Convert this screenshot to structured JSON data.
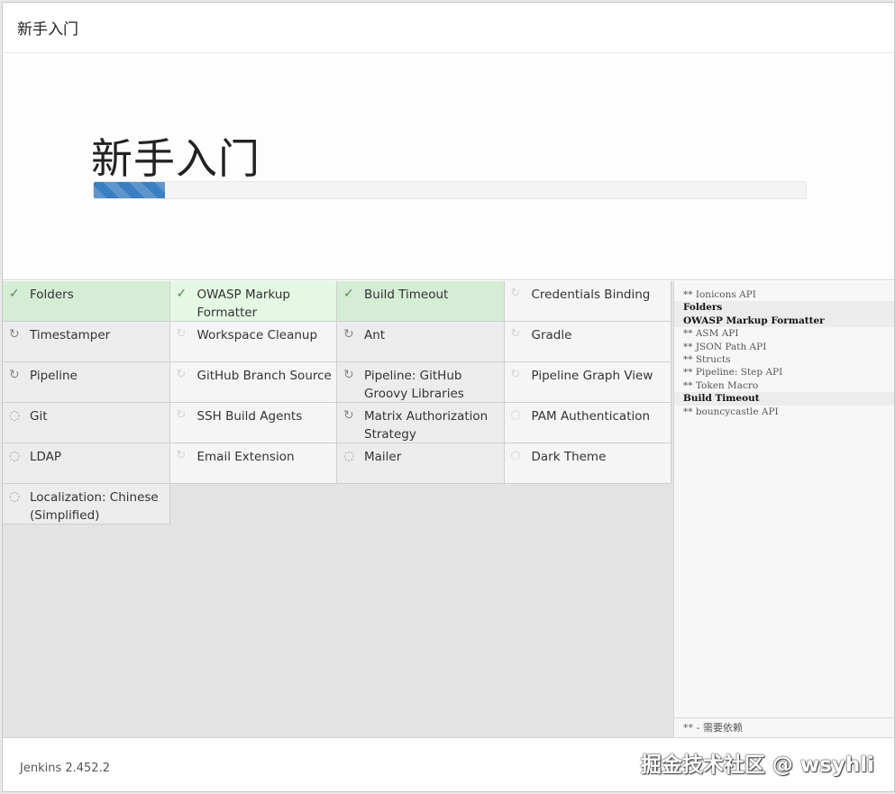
{
  "header": {
    "title": "新手入门"
  },
  "hero": {
    "title": "新手入门",
    "progress_percent": 10
  },
  "plugins": [
    {
      "label": "Folders",
      "status": "success",
      "icon": "check-icon"
    },
    {
      "label": "OWASP Markup Formatter",
      "status": "success-light",
      "icon": "check-icon"
    },
    {
      "label": "Build Timeout",
      "status": "success",
      "icon": "check-icon"
    },
    {
      "label": "Credentials Binding",
      "status": "queued-pending",
      "icon": "refresh-icon"
    },
    {
      "label": "Timestamper",
      "status": "pending",
      "icon": "refresh-icon"
    },
    {
      "label": "Workspace Cleanup",
      "status": "queued-pending",
      "icon": "refresh-icon"
    },
    {
      "label": "Ant",
      "status": "pending",
      "icon": "refresh-icon"
    },
    {
      "label": "Gradle",
      "status": "queued-pending",
      "icon": "refresh-icon"
    },
    {
      "label": "Pipeline",
      "status": "pending",
      "icon": "refresh-icon"
    },
    {
      "label": "GitHub Branch Source",
      "status": "queued-pending",
      "icon": "refresh-icon"
    },
    {
      "label": "Pipeline: GitHub Groovy Libraries",
      "status": "pending",
      "icon": "refresh-icon"
    },
    {
      "label": "Pipeline Graph View",
      "status": "queued-pending",
      "icon": "refresh-icon"
    },
    {
      "label": "Git",
      "status": "pending",
      "icon": "spinner-icon"
    },
    {
      "label": "SSH Build Agents",
      "status": "queued-pending",
      "icon": "refresh-icon"
    },
    {
      "label": "Matrix Authorization Strategy",
      "status": "pending",
      "icon": "refresh-icon"
    },
    {
      "label": "PAM Authentication",
      "status": "queued",
      "icon": "circle-icon"
    },
    {
      "label": "LDAP",
      "status": "pending",
      "icon": "spinner-icon"
    },
    {
      "label": "Email Extension",
      "status": "queued-pending",
      "icon": "refresh-icon"
    },
    {
      "label": "Mailer",
      "status": "pending",
      "icon": "spinner-icon"
    },
    {
      "label": "Dark Theme",
      "status": "queued",
      "icon": "circle-icon"
    },
    {
      "label": "Localization: Chinese (Simplified)",
      "status": "pending",
      "icon": "spinner-icon"
    }
  ],
  "log": {
    "lines": [
      {
        "text": "** Ionicons API",
        "bold": false
      },
      {
        "text": "Folders",
        "bold": true
      },
      {
        "text": "OWASP Markup Formatter",
        "bold": true
      },
      {
        "text": "** ASM API",
        "bold": false
      },
      {
        "text": "** JSON Path API",
        "bold": false
      },
      {
        "text": "** Structs",
        "bold": false
      },
      {
        "text": "** Pipeline: Step API",
        "bold": false
      },
      {
        "text": "** Token Macro",
        "bold": false
      },
      {
        "text": "Build Timeout",
        "bold": true
      },
      {
        "text": "** bouncycastle API",
        "bold": false
      }
    ],
    "footer_note": "** - 需要依赖"
  },
  "footer": {
    "version": "Jenkins 2.452.2",
    "watermark": "掘金技术社区 @ wsyhli"
  },
  "colors": {
    "progress": "#3a7fc1",
    "success_bg": "#d5ecd5",
    "pending_bg": "#ececec",
    "queued_bg": "#f5f5f5"
  }
}
